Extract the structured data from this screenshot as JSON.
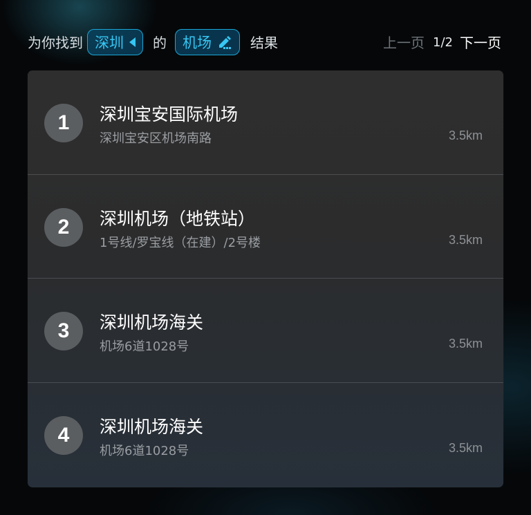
{
  "header": {
    "prefix": "为你找到",
    "city_chip": "深圳",
    "connector": "的",
    "keyword_chip": "机场",
    "suffix": "结果",
    "prev_label": "上一页",
    "page_indicator": "1/2",
    "next_label": "下一页"
  },
  "results": [
    {
      "index": "1",
      "name": "深圳宝安国际机场",
      "address": "深圳宝安区机场南路",
      "distance": "3.5km"
    },
    {
      "index": "2",
      "name": "深圳机场（地铁站）",
      "address": "1号线/罗宝线（在建）/2号楼",
      "distance": "3.5km"
    },
    {
      "index": "3",
      "name": "深圳机场海关",
      "address": "机场6道1028号",
      "distance": "3.5km"
    },
    {
      "index": "4",
      "name": "深圳机场海关",
      "address": "机场6道1028号",
      "distance": "3.5km"
    }
  ],
  "colors": {
    "accent": "#37c6f2",
    "chip_border": "#1aa6d6",
    "panel_bg": "#2f2e2e",
    "index_circle": "#5b5e61"
  },
  "icons": {
    "city_chip_icon": "triangle-left-icon",
    "keyword_chip_icon": "edit-pen-icon"
  }
}
